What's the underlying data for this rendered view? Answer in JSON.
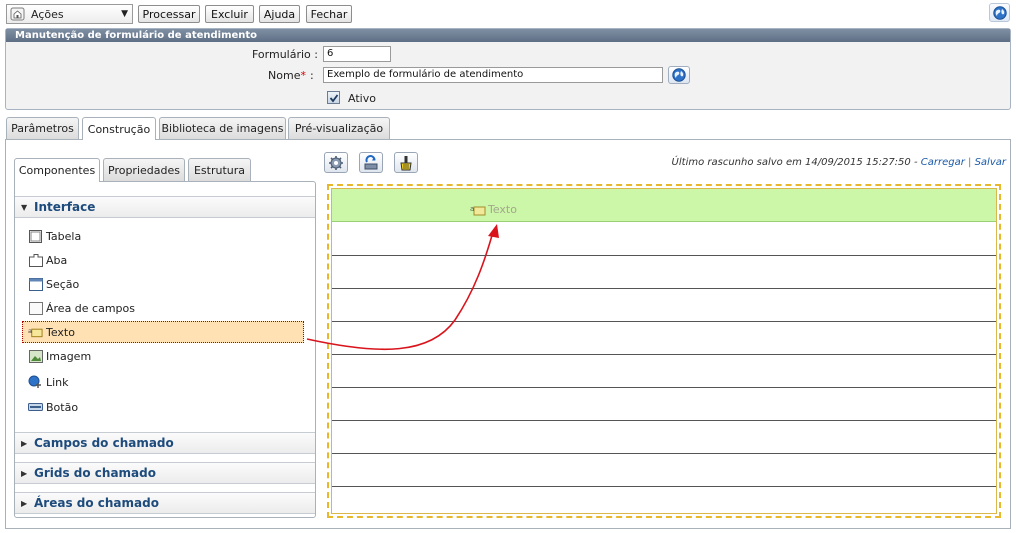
{
  "toolbar": {
    "actions_label": "Ações",
    "processar": "Processar",
    "excluir": "Excluir",
    "ajuda": "Ajuda",
    "fechar": "Fechar"
  },
  "panel": {
    "title": "Manutenção de formulário de atendimento",
    "formulario_label": "Formulário :",
    "formulario_value": "6",
    "nome_label": "Nome",
    "nome_required": "*",
    "nome_colon": ":",
    "nome_value": "Exemplo de formulário de atendimento",
    "ativo_label": "Ativo",
    "ativo_checked": true
  },
  "tabs": [
    {
      "label": "Parâmetros"
    },
    {
      "label": "Construção"
    },
    {
      "label": "Biblioteca de imagens"
    },
    {
      "label": "Pré-visualização"
    }
  ],
  "sub_tabs": [
    {
      "label": "Componentes"
    },
    {
      "label": "Propriedades"
    },
    {
      "label": "Estrutura"
    }
  ],
  "sections": {
    "interface": "Interface",
    "campos": "Campos do chamado",
    "grids": "Grids do chamado",
    "areas": "Áreas do chamado"
  },
  "components": [
    {
      "label": "Tabela",
      "icon": "table-icon"
    },
    {
      "label": "Aba",
      "icon": "tab-icon"
    },
    {
      "label": "Seção",
      "icon": "section-icon"
    },
    {
      "label": "Área de campos",
      "icon": "field-area-icon"
    },
    {
      "label": "Texto",
      "icon": "text-icon"
    },
    {
      "label": "Imagem",
      "icon": "image-icon"
    },
    {
      "label": "Link",
      "icon": "link-icon"
    },
    {
      "label": "Botão",
      "icon": "button-icon"
    }
  ],
  "draft": {
    "status": "Último rascunho salvo em 14/09/2015 15:27:50 -",
    "carregar": "Carregar",
    "separator": "|",
    "salvar": "Salvar"
  },
  "canvas": {
    "ghost_label": "Texto"
  },
  "colors": {
    "header_bar": "#6b7b90",
    "drop_highlight": "#ccf7a8",
    "canvas_border": "#e8b82a",
    "selected_item": "#ffe1b4",
    "arrow": "#d9141c"
  }
}
